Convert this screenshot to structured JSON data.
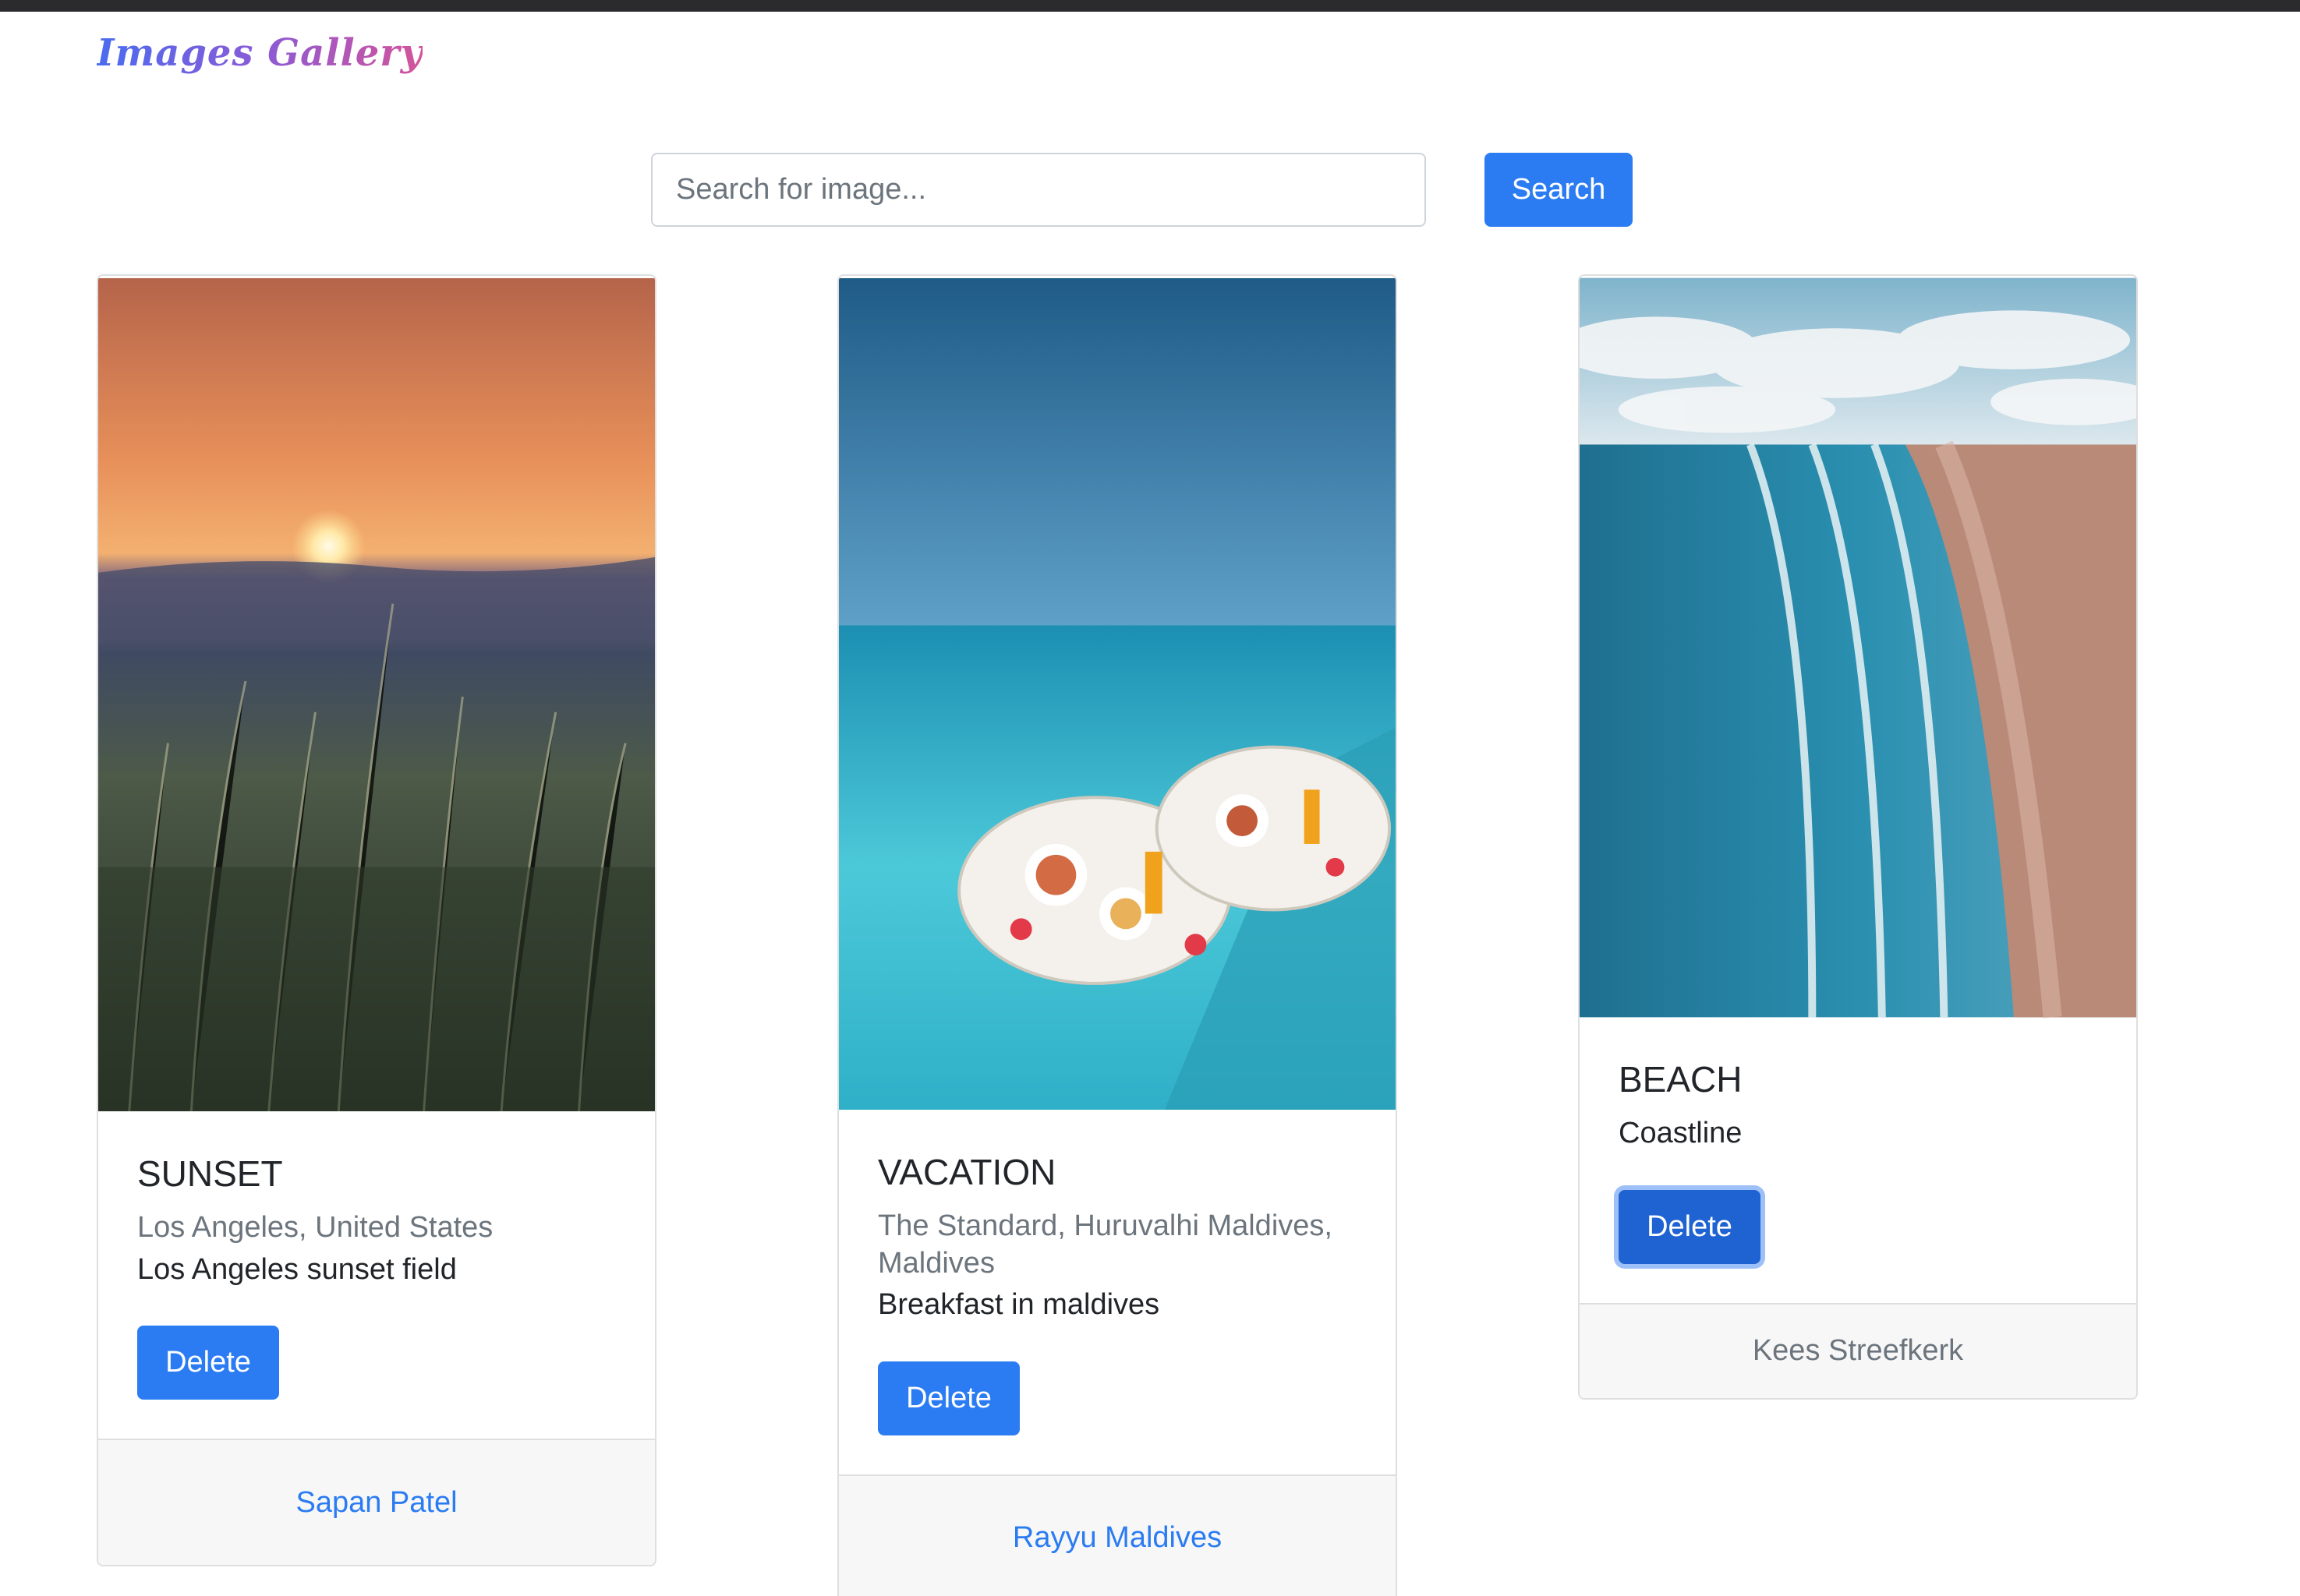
{
  "app": {
    "brand": "Images Gallery"
  },
  "search": {
    "placeholder": "Search for image...",
    "button_label": "Search"
  },
  "cards": [
    {
      "title": "SUNSET",
      "location": "Los Angeles, United States",
      "description": "Los Angeles sunset field",
      "delete_label": "Delete",
      "author": "Sapan Patel"
    },
    {
      "title": "VACATION",
      "location": "The Standard, Huruvalhi Maldives, Maldives",
      "description": "Breakfast in maldives",
      "delete_label": "Delete",
      "author": "Rayyu Maldives"
    },
    {
      "title": "BEACH",
      "description": "Coastline",
      "delete_label": "Delete",
      "author": "Kees Streefkerk"
    }
  ],
  "colors": {
    "primary": "#2b7cf2",
    "border": "#dfdfdf",
    "muted": "#6c757d"
  }
}
